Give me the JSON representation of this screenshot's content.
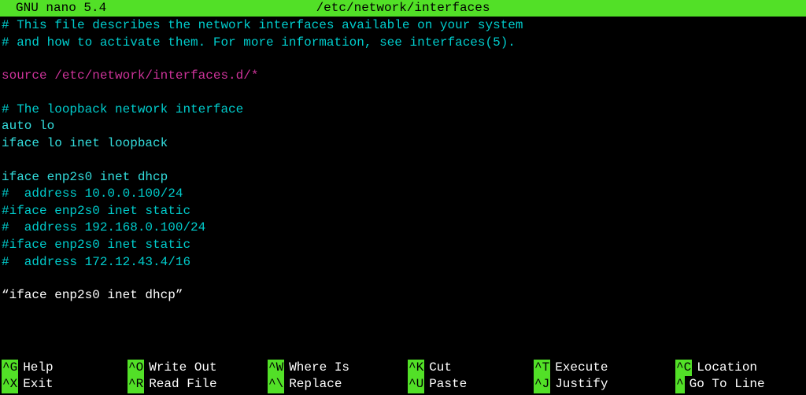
{
  "header": {
    "app": "GNU nano 5.4",
    "filename": "/etc/network/interfaces"
  },
  "lines": [
    {
      "text": "# This file describes the network interfaces available on your system",
      "class": "cyan"
    },
    {
      "text": "# and how to activate them. For more information, see interfaces(5).",
      "class": "cyan"
    },
    {
      "text": "",
      "class": "cyan"
    },
    {
      "text": "source /etc/network/interfaces.d/*",
      "class": "magenta"
    },
    {
      "text": "",
      "class": "cyan"
    },
    {
      "text": "# The loopback network interface",
      "class": "cyan"
    },
    {
      "text": "auto lo",
      "class": "bright-cyan"
    },
    {
      "text": "iface lo inet loopback",
      "class": "bright-cyan"
    },
    {
      "text": "",
      "class": "cyan"
    },
    {
      "text": "iface enp2s0 inet dhcp",
      "class": "bright-cyan"
    },
    {
      "text": "#  address 10.0.0.100/24",
      "class": "cyan"
    },
    {
      "text": "#iface enp2s0 inet static",
      "class": "cyan"
    },
    {
      "text": "#  address 192.168.0.100/24",
      "class": "cyan"
    },
    {
      "text": "#iface enp2s0 inet static",
      "class": "cyan"
    },
    {
      "text": "#  address 172.12.43.4/16",
      "class": "cyan"
    },
    {
      "text": "",
      "class": "cyan"
    },
    {
      "text": "“iface enp2s0 inet dhcp”",
      "class": "white"
    }
  ],
  "shortcuts": {
    "row1": [
      {
        "key": "^G",
        "label": "Help"
      },
      {
        "key": "^O",
        "label": "Write Out"
      },
      {
        "key": "^W",
        "label": "Where Is"
      },
      {
        "key": "^K",
        "label": "Cut"
      },
      {
        "key": "^T",
        "label": "Execute"
      },
      {
        "key": "^C",
        "label": "Location"
      }
    ],
    "row2": [
      {
        "key": "^X",
        "label": "Exit"
      },
      {
        "key": "^R",
        "label": "Read File"
      },
      {
        "key": "^\\",
        "label": "Replace"
      },
      {
        "key": "^U",
        "label": "Paste"
      },
      {
        "key": "^J",
        "label": "Justify"
      },
      {
        "key": "^ ",
        "label": "Go To Line"
      }
    ]
  }
}
